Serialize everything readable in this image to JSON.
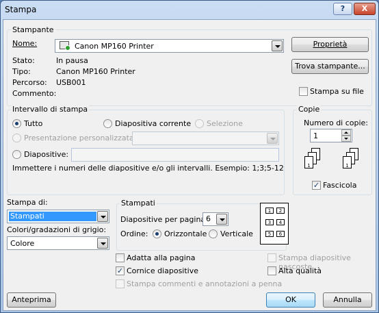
{
  "window": {
    "title": "Stampa",
    "help_label": "?",
    "close_label": "X"
  },
  "printer": {
    "legend": "Stampante",
    "name_label": "Nome:",
    "name_value": "Canon MP160 Printer",
    "status_label": "Stato:",
    "status_value": "In pausa",
    "type_label": "Tipo:",
    "type_value": "Canon MP160 Printer",
    "where_label": "Percorso:",
    "where_value": "USB001",
    "comment_label": "Commento:",
    "comment_value": "",
    "properties_button": "Proprietà",
    "find_button": "Trova stampante...",
    "print_to_file_label": "Stampa su file",
    "print_to_file_checked": false
  },
  "range": {
    "legend": "Intervallo di stampa",
    "all_label": "Tutto",
    "current_label": "Diapositiva corrente",
    "selection_label": "Selezione",
    "custom_label": "Presentazione personalizzata:",
    "slides_label": "Diapositive:",
    "slides_value": "",
    "hint": "Immettere i numeri delle diapositive e/o gli intervalli. Esempio: 1;3;5-12",
    "selected": "all"
  },
  "copies": {
    "legend": "Copie",
    "count_label": "Numero di copie:",
    "count_value": "1",
    "collate_label": "Fascicola",
    "collate_checked": true,
    "collate_pages": [
      "1",
      "2",
      "3"
    ]
  },
  "print_what": {
    "label": "Stampa di:",
    "value": "Stampati",
    "color_label": "Colori/gradazioni di grigio:",
    "color_value": "Colore"
  },
  "handouts": {
    "legend": "Stampati",
    "per_page_label": "Diapositive per pagina:",
    "per_page_value": "6",
    "order_label": "Ordine:",
    "horizontal_label": "Orizzontale",
    "vertical_label": "Verticale",
    "order_selected": "horizontal",
    "preview_numbers": [
      "1",
      "2",
      "3",
      "4",
      "5",
      "6"
    ]
  },
  "options": {
    "fit_label": "Adatta alla pagina",
    "fit_checked": false,
    "frame_label": "Cornice diapositive",
    "frame_checked": true,
    "comments_label": "Stampa commenti e annotazioni a penna",
    "comments_checked": false,
    "hidden_label": "Stampa diapositive nascoste",
    "hidden_checked": false,
    "quality_label": "Alta qualità",
    "quality_checked": false
  },
  "footer": {
    "preview_button": "Anteprima",
    "ok_button": "OK",
    "cancel_button": "Annulla"
  },
  "colors": {
    "title_bar": "#b9d1ee",
    "close_button": "#c6452a",
    "dialog_bg": "#f0f0f0",
    "selection": "#3399ff"
  }
}
